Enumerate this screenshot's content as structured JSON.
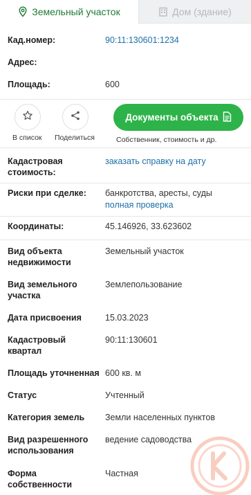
{
  "tabs": {
    "land_label": "Земельный участок",
    "house_label": "Дом (здание)",
    "land_icon": "location-pin-icon",
    "house_icon": "building-icon"
  },
  "summary": {
    "cadnum_label": "Кад.номер:",
    "cadnum_value": "90:11:130601:1234",
    "address_label": "Адрес:",
    "area_label": "Площадь:",
    "area_value": "600"
  },
  "actions": {
    "favorite_label": "В список",
    "favorite_icon": "star-icon",
    "share_label": "Поделиться",
    "share_icon": "share-icon",
    "documents_label": "Документы объекта",
    "documents_icon": "document-icon",
    "documents_sub": "Собственник, стоимость и др."
  },
  "details": {
    "cadvalue_label_1": "Кадастровая",
    "cadvalue_label_2": "стоимость:",
    "cadvalue_link": "заказать справку на дату",
    "risks_label": "Риски при сделке:",
    "risks_value": "банкротства, аресты, суды",
    "risks_link": "полная проверка",
    "coords_label": "Координаты:",
    "coords_value": "45.146926, 33.623602",
    "objtype_label_1": "Вид объекта",
    "objtype_label_2": "недвижимости",
    "objtype_value": "Земельный участок",
    "landtype_label_1": "Вид земельного",
    "landtype_label_2": "участка",
    "landtype_value": "Землепользование",
    "date_label": "Дата присвоения",
    "date_value": "15.03.2023",
    "quarter_label_1": "Кадастровый",
    "quarter_label_2": "квартал",
    "quarter_value": "90:11:130601",
    "refined_area_label": "Площадь уточненная",
    "refined_area_value": "600 кв. м",
    "status_label": "Статус",
    "status_value": "Учтенный",
    "category_label": "Категория земель",
    "category_value": "Земли населенных пунктов",
    "permitted_label_1": "Вид разрешенного",
    "permitted_label_2": "использования",
    "permitted_value": "ведение садоводства",
    "ownership_label_1": "Форма",
    "ownership_label_2": "собственности",
    "ownership_value": "Частная"
  },
  "colors": {
    "accent_green": "#2db349",
    "tab_green": "#1f7a34",
    "link_blue": "#1d6fa8",
    "watermark_orange": "#f3a58e"
  }
}
